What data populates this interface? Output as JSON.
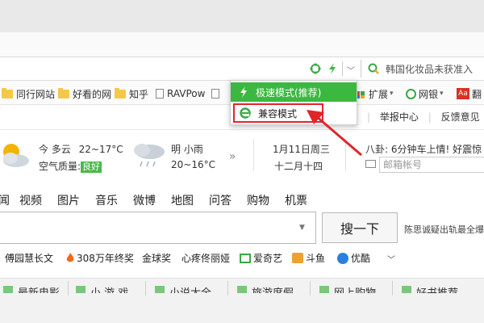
{
  "address_bar": {
    "compat_icon": "ie-compat-icon",
    "speed_icon": "lightning-icon",
    "search_text": "韩国化妆品未获准入"
  },
  "bookmarks": [
    {
      "label": "同行网站",
      "icon": "folder-icon"
    },
    {
      "label": "好看的网",
      "icon": "folder-icon"
    },
    {
      "label": "知乎",
      "icon": "folder-icon"
    },
    {
      "label": "RAVPow",
      "icon": "page-icon"
    },
    {
      "label": "扩展",
      "icon": "extension-icon"
    },
    {
      "label": "网银",
      "icon": "netbank-icon"
    },
    {
      "label": "翻",
      "icon": "ad-icon"
    }
  ],
  "mode_menu": {
    "speed_mode": "极速模式(推荐)",
    "compat_mode": "兼容模式",
    "highlight_color": "#e0262b",
    "active_color": "#3bb83f"
  },
  "top_links": [
    "举报中心",
    "反馈意见"
  ],
  "weather": {
    "today_label": "今 多云",
    "today_temp": "22~17°C",
    "aqi_label": "空气质量:",
    "aqi_value": "良好",
    "tomorrow_label": "明 小雨",
    "tomorrow_temp": "20~16°C",
    "more": "»"
  },
  "date": {
    "solar": "1月11日周三",
    "lunar": "十二月十四"
  },
  "gossip": "八卦: 6分钟车上情! 好震惊",
  "mail_placeholder": "邮箱帐号",
  "nav_tabs": [
    "闻",
    "视频",
    "图片",
    "音乐",
    "微博",
    "地图",
    "问答",
    "购物",
    "机票"
  ],
  "search": {
    "button": "搜一下",
    "hot": "陈思诚疑出轨最全爆"
  },
  "quick_links": [
    "傅园慧长文",
    "308万年终奖",
    "金球奖",
    "心疼佟丽娅",
    "爱奇艺",
    "斗鱼",
    "优酷"
  ],
  "categories": [
    "最新电影",
    "小 游 戏",
    "小说大全",
    "旅游度假",
    "网上购物",
    "好书推荐"
  ]
}
